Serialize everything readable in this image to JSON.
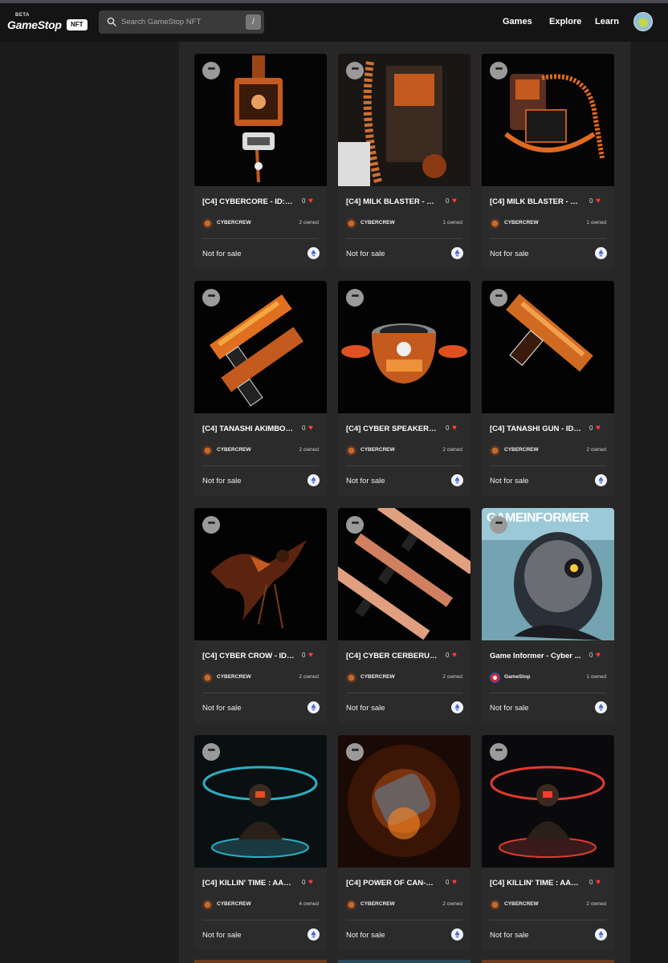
{
  "header": {
    "logo_beta": "BETA",
    "logo_text": "GameStop",
    "logo_badge": "NFT",
    "search_placeholder": "Search GameStop NFT",
    "search_shortcut": "/",
    "nav": [
      "Games",
      "Explore",
      "Learn"
    ]
  },
  "cards": [
    {
      "title": "[C4] CYBERCORE - ID:G18",
      "likes": "0",
      "creator": "CYBERCREW",
      "owned": "2 owned",
      "sale": "Not for sale",
      "art": "backpack-core"
    },
    {
      "title": "[C4] MILK BLASTER - EXP...",
      "likes": "0",
      "creator": "CYBERCREW",
      "owned": "1 owned",
      "sale": "Not for sale",
      "art": "milk-blaster-closeup"
    },
    {
      "title": "[C4] MILK BLASTER - EXP...",
      "likes": "0",
      "creator": "CYBERCREW",
      "owned": "1 owned",
      "sale": "Not for sale",
      "art": "milk-blaster"
    },
    {
      "title": "[C4] TANASHI AKIMBO -...",
      "likes": "0",
      "creator": "CYBERCREW",
      "owned": "2 owned",
      "sale": "Not for sale",
      "art": "dual-guns"
    },
    {
      "title": "[C4] CYBER SPEAKER - I...",
      "likes": "0",
      "creator": "CYBERCREW",
      "owned": "2 owned",
      "sale": "Not for sale",
      "art": "speaker"
    },
    {
      "title": "[C4] TANASHI GUN - ID:...",
      "likes": "0",
      "creator": "CYBERCREW",
      "owned": "2 owned",
      "sale": "Not for sale",
      "art": "gun"
    },
    {
      "title": "[C4] CYBER CROW - ID:...",
      "likes": "0",
      "creator": "CYBERCREW",
      "owned": "2 owned",
      "sale": "Not for sale",
      "art": "crow"
    },
    {
      "title": "[C4] CYBER CERBERUS -...",
      "likes": "0",
      "creator": "CYBERCREW",
      "owned": "2 owned",
      "sale": "Not for sale",
      "art": "cerberus"
    },
    {
      "title": "Game Informer - Cyber ...",
      "likes": "0",
      "creator": "GameStop",
      "owned": "1 owned",
      "sale": "Not for sale",
      "art": "game-informer",
      "magazine": "GAMEINFORMER"
    },
    {
      "title": "[C4] KILLIN' TIME : AA#01...",
      "likes": "0",
      "creator": "CYBERCREW",
      "owned": "4 owned",
      "sale": "Not for sale",
      "art": "killin-time-cyan"
    },
    {
      "title": "[C4] POWER OF CAN-D:...",
      "likes": "0",
      "creator": "CYBERCREW",
      "owned": "2 owned",
      "sale": "Not for sale",
      "art": "power-can"
    },
    {
      "title": "[C4] KILLIN' TIME : AA#01...",
      "likes": "0",
      "creator": "CYBERCREW",
      "owned": "2 owned",
      "sale": "Not for sale",
      "art": "killin-time-red"
    }
  ],
  "colors": {
    "accent": "#e0651c",
    "heart": "#ff3b3b",
    "bg": "#1c1c1c",
    "card": "#2b2b2b"
  }
}
